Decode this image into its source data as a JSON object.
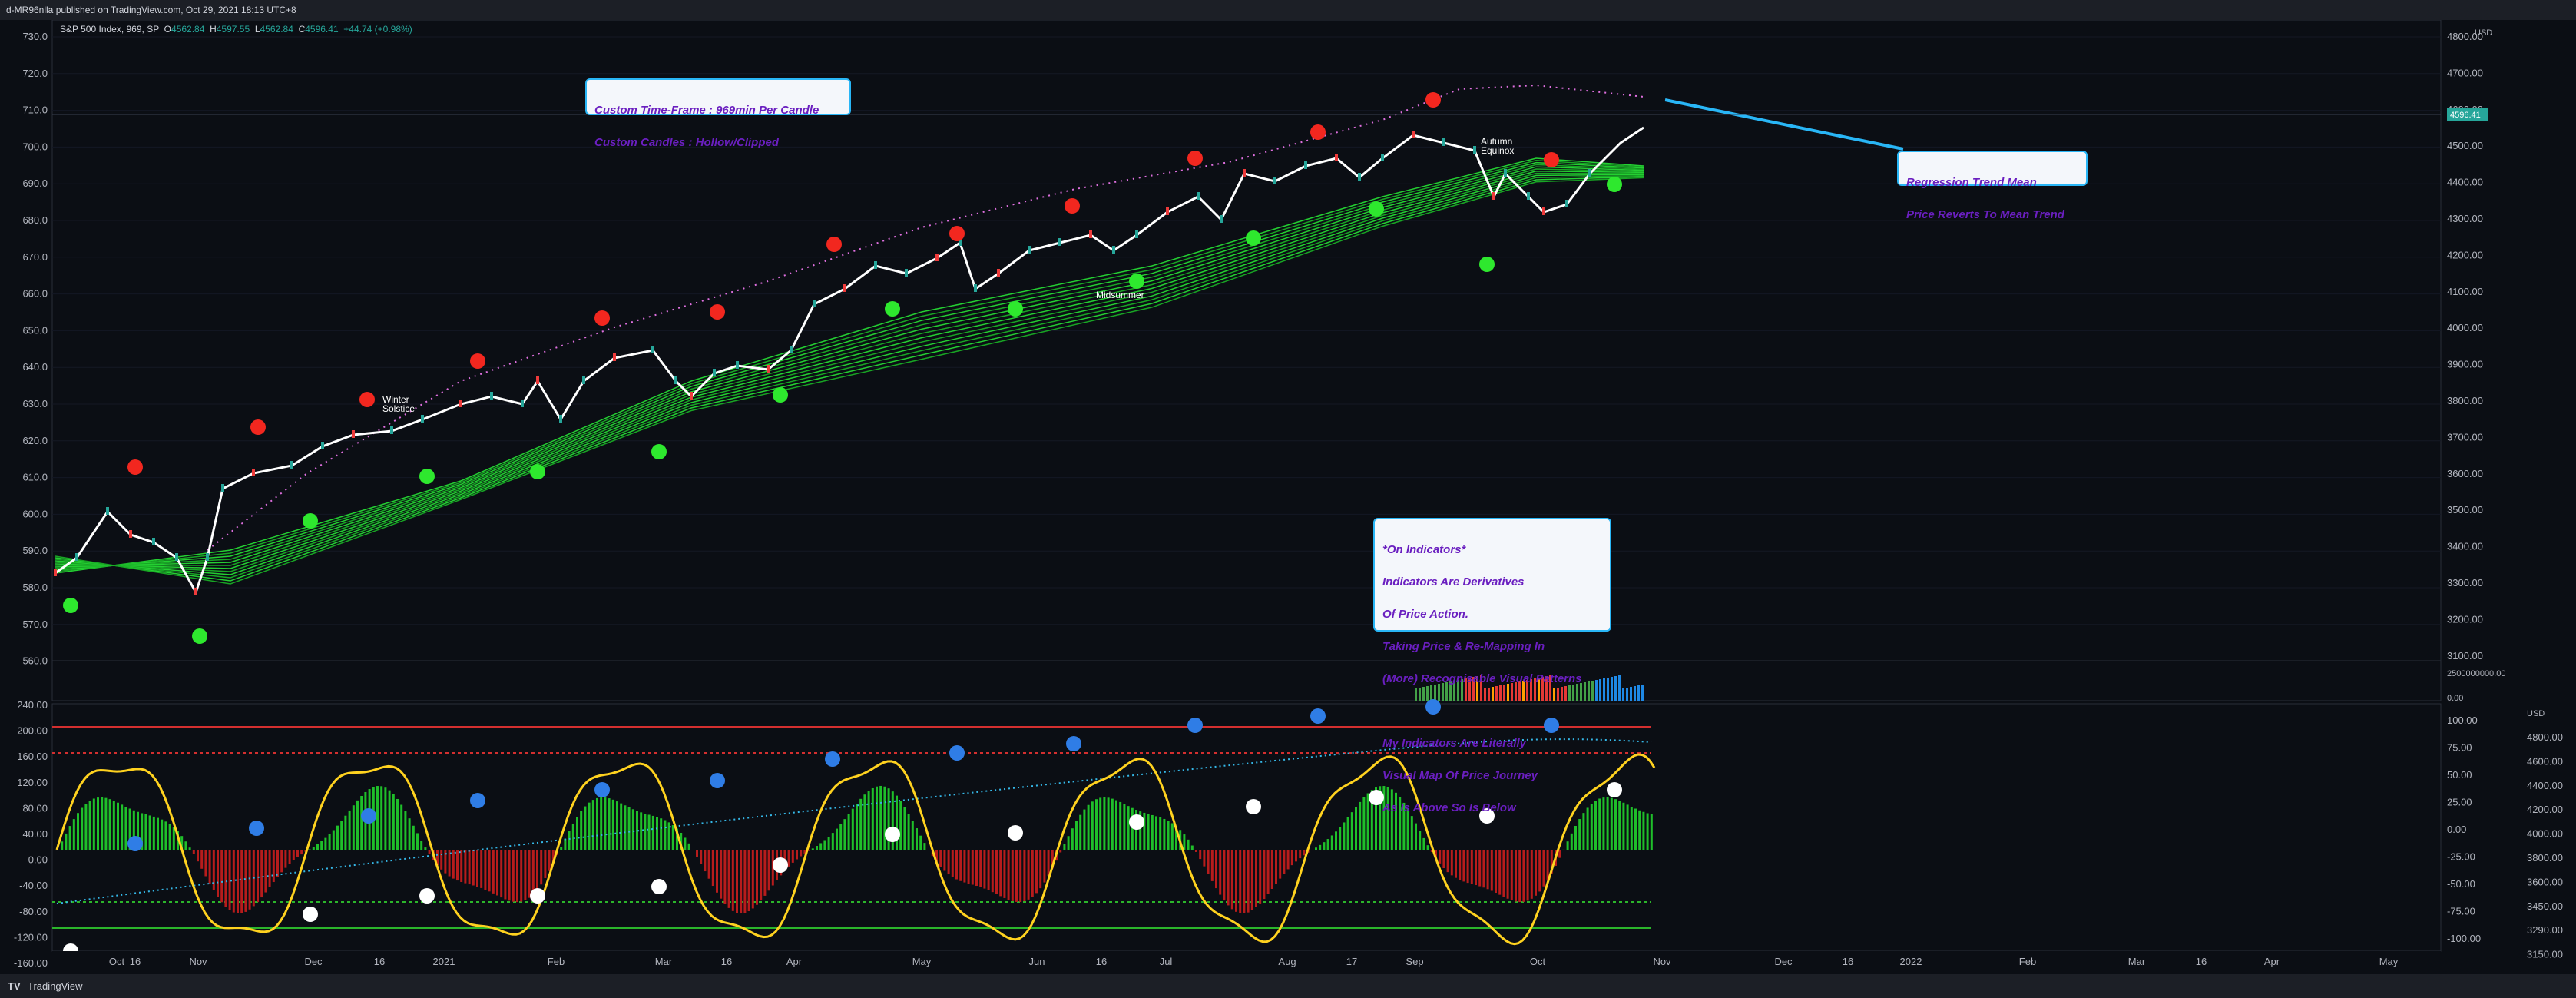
{
  "header": {
    "publish_line": "d-MR96nlla published on TradingView.com, Oct 29, 2021 18:13 UTC+8"
  },
  "legend": {
    "symbol": "S&P 500 Index, 969, SP",
    "open_label": "O",
    "open": "4562.84",
    "high_label": "H",
    "high": "4597.55",
    "low_label": "L",
    "low": "4562.84",
    "close_label": "C",
    "close": "4596.41",
    "change": "+44.74 (+0.98%)"
  },
  "callouts": {
    "timeframe": [
      "Custom Time-Frame : 969min Per Candle",
      "Custom Candles : Hollow/Clipped"
    ],
    "regression": [
      "Regression Trend Mean",
      "Price Reverts To Mean Trend"
    ],
    "indicators": [
      "*On Indicators*",
      "Indicators Are Derivatives",
      "Of Price Action.",
      "Taking Price & Re-Mapping In",
      "(More) Recognisable Visual Patterns",
      "",
      "My Indicators Are Literally",
      "Visual Map Of Price Journey",
      "As Is Above So Is Below"
    ]
  },
  "annotations": {
    "winter": [
      "Winter",
      "Solstice"
    ],
    "midsummer": "Midsummer",
    "autumn": [
      "Autumn",
      "Equinox"
    ]
  },
  "main_axis": {
    "left_ticks": [
      "730.0",
      "720.0",
      "710.0",
      "700.0",
      "690.0",
      "680.0",
      "670.0",
      "660.0",
      "650.0",
      "640.0",
      "630.0",
      "620.0",
      "610.0",
      "600.0",
      "590.0",
      "580.0",
      "570.0",
      "560.0"
    ],
    "right_ticks": [
      "4800.00",
      "4700.00",
      "4600.00",
      "4500.00",
      "4400.00",
      "4300.00",
      "4200.00",
      "4100.00",
      "4000.00",
      "3900.00",
      "3800.00",
      "3700.00",
      "3600.00",
      "3500.00",
      "3400.00",
      "3300.00",
      "3200.00",
      "3100.00"
    ],
    "currency": "USD",
    "last_price": "4596.41"
  },
  "volume_axis": {
    "ticks": [
      "2500000000.00",
      "0.00"
    ]
  },
  "osc_axis": {
    "left_ticks": [
      "240.00",
      "200.00",
      "160.00",
      "120.00",
      "80.00",
      "40.00",
      "0.00",
      "-40.00",
      "-80.00",
      "-120.00",
      "-160.00"
    ],
    "right_ticks": [
      "100.00",
      "75.00",
      "50.00",
      "25.00",
      "0.00",
      "-25.00",
      "-50.00",
      "-75.00",
      "-100.00"
    ],
    "currency": "USD",
    "usd_ticks": [
      "4800.00",
      "4600.00",
      "4400.00",
      "4200.00",
      "4000.00",
      "3800.00",
      "3600.00",
      "3450.00",
      "3290.00",
      "3150.00"
    ]
  },
  "time_axis": {
    "labels": [
      "Oct",
      "16",
      "Nov",
      "Dec",
      "16",
      "2021",
      "Feb",
      "Mar",
      "16",
      "Apr",
      "May",
      "Jun",
      "16",
      "Jul",
      "Aug",
      "17",
      "Sep",
      "Oct",
      "Nov",
      "Dec",
      "16",
      "2022",
      "Feb",
      "Mar",
      "16",
      "Apr",
      "May"
    ]
  },
  "footer": {
    "brand": "TradingView"
  },
  "colors": {
    "background": "#0b0e14",
    "price_line": "#ffffff",
    "ribbon": "#1fbf2a",
    "high_dot": "#f2271f",
    "low_dot": "#2ee82e",
    "oscillator": "#ffd21f",
    "osc_high_dot": "#2f7de6",
    "osc_low_dot": "#ffffff",
    "callout_text": "#6a1fc0",
    "callout_border": "#29b6f6"
  }
}
